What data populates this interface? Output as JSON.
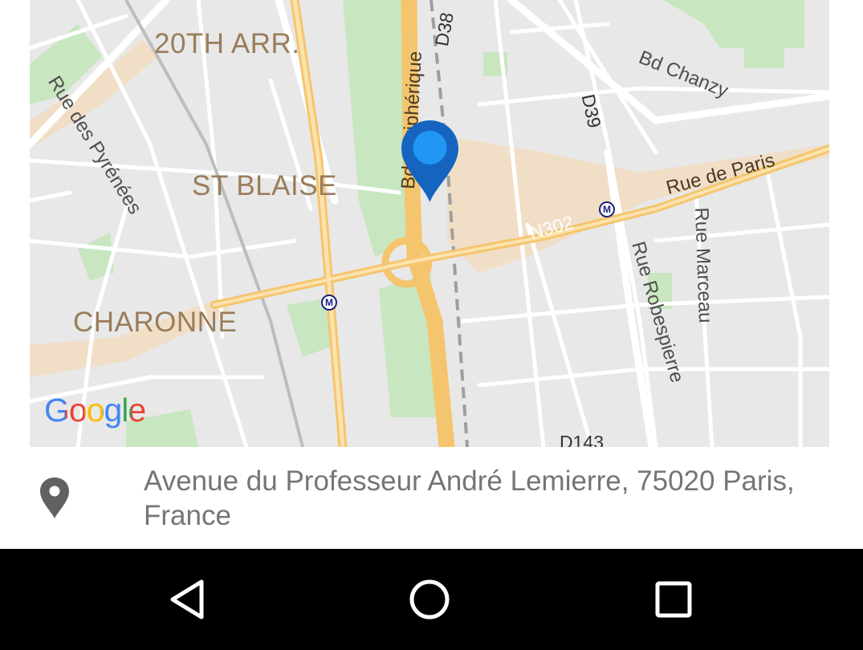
{
  "map": {
    "districts": [
      "20TH ARR.",
      "ST BLAISE",
      "CHARONNE"
    ],
    "streets": [
      "Rue des Pyrénées",
      "Bd Chanzy",
      "Rue de Paris",
      "Rue Robespierre",
      "Rue Marceau",
      "Bd Périphérique"
    ],
    "routes": [
      "D38",
      "D39",
      "N302",
      "D143"
    ],
    "metro_symbol": "M",
    "logo": "Google",
    "marker_color": "#1565c0"
  },
  "location": {
    "icon": "location-pin-icon",
    "address": "Avenue du Professeur André Lemierre, 75020 Paris, France"
  },
  "navbar": {
    "back": "back-icon",
    "home": "home-icon",
    "recents": "recents-icon"
  }
}
